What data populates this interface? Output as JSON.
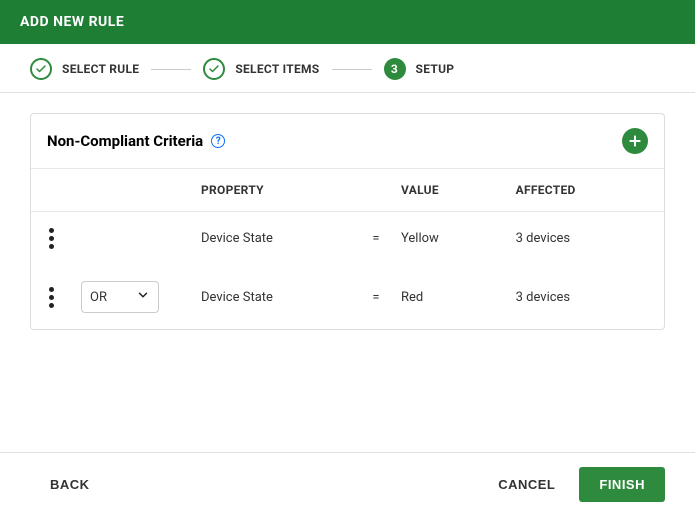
{
  "header": {
    "title": "ADD NEW RULE"
  },
  "stepper": {
    "step1": {
      "label": "SELECT RULE",
      "state": "done"
    },
    "step2": {
      "label": "SELECT ITEMS",
      "state": "done"
    },
    "step3": {
      "label": "SETUP",
      "number": "3",
      "state": "active"
    }
  },
  "card": {
    "title": "Non-Compliant Criteria",
    "help": "?",
    "columns": {
      "property": "PROPERTY",
      "value": "VALUE",
      "affected": "AFFECTED"
    },
    "rows": [
      {
        "operator": "",
        "property": "Device State",
        "comparator": "=",
        "value": "Yellow",
        "affected": "3 devices"
      },
      {
        "operator": "OR",
        "property": "Device State",
        "comparator": "=",
        "value": "Red",
        "affected": "3 devices"
      }
    ]
  },
  "footer": {
    "back": "BACK",
    "cancel": "CANCEL",
    "finish": "FINISH"
  }
}
